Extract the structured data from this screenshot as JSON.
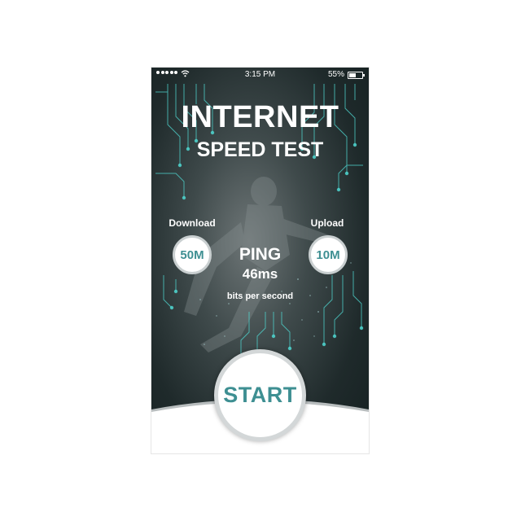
{
  "status_bar": {
    "time": "3:15 PM",
    "battery_percent": "55%",
    "battery_level": 0.55,
    "signal_icon": "signal-dots-icon",
    "wifi_icon": "wifi-icon"
  },
  "title": {
    "line1": "INTERNET",
    "line2": "SPEED TEST"
  },
  "download": {
    "label": "Download",
    "value": "50M"
  },
  "upload": {
    "label": "Upload",
    "value": "10M"
  },
  "ping": {
    "label": "PING",
    "value": "46ms"
  },
  "units_caption": "bits per second",
  "start_button": {
    "label": "START"
  },
  "colors": {
    "accent_teal": "#3e8f92",
    "circuit_cyan": "#4fd6d0",
    "background_dark": "#1f2a2b"
  }
}
